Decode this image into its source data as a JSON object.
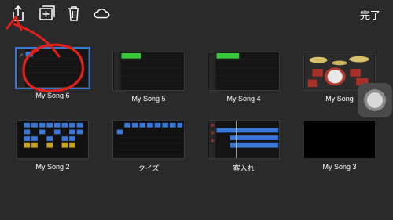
{
  "toolbar": {
    "icons": [
      "share-icon",
      "add-icon",
      "trash-icon",
      "cloud-icon"
    ],
    "done_label": "完了"
  },
  "songs": [
    {
      "label": "My Song 6",
      "selected": true
    },
    {
      "label": "My Song 5",
      "selected": false
    },
    {
      "label": "My Song 4",
      "selected": false
    },
    {
      "label": "My Song",
      "selected": false
    },
    {
      "label": "My Song 2",
      "selected": false
    },
    {
      "label": "クイズ",
      "selected": false
    },
    {
      "label": "客入れ",
      "selected": false
    },
    {
      "label": "My Song 3",
      "selected": false
    }
  ],
  "colors": {
    "background": "#2a2a2a",
    "accent_blue": "#3a78d8",
    "region_green": "#39c93a",
    "annotation_red": "#e0201a"
  }
}
